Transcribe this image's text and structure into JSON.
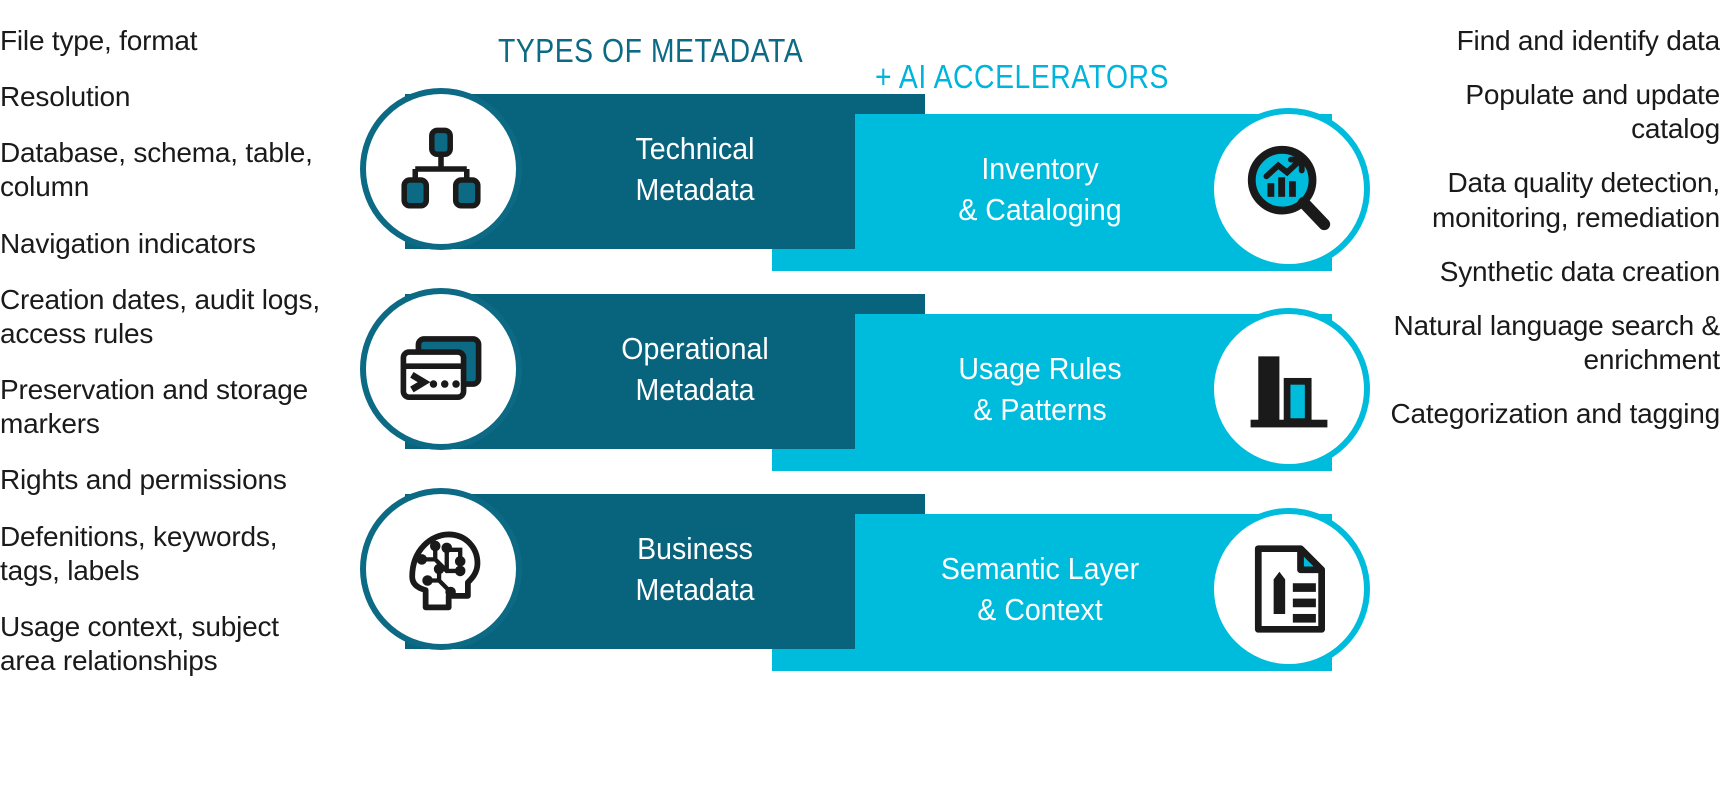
{
  "headings": {
    "left": "TYPES OF METADATA",
    "right": "+ AI ACCELERATORS"
  },
  "colors": {
    "dark_teal": "#08637d",
    "circle_teal": "#0d6a84",
    "cyan": "#00bcdc",
    "heading_cyan": "#00b4dc",
    "text": "#1a1a1a",
    "white": "#ffffff"
  },
  "left_column": [
    {
      "text": "File type, format"
    },
    {
      "text": "Resolution"
    },
    {
      "text": "Database, schema, table, column"
    },
    {
      "text": "Navigation indicators"
    },
    {
      "text": "Creation dates, audit logs, access rules"
    },
    {
      "text": "Preservation and storage markers"
    },
    {
      "text": "Rights and permissions"
    },
    {
      "text": "Defenitions, keywords, tags, labels"
    },
    {
      "text": "Usage context, subject area relationships"
    }
  ],
  "right_column": [
    {
      "text": "Find and identify data"
    },
    {
      "text": "Populate and update catalog"
    },
    {
      "text": "Data quality detection, monitoring, remediation"
    },
    {
      "text": "Synthetic data creation"
    },
    {
      "text": "Natural language search & enrichment"
    },
    {
      "text": "Categorization and tagging"
    }
  ],
  "rows": [
    {
      "metadata_label": "Technical\nMetadata",
      "accelerator_label": "Inventory\n& Cataloging",
      "metadata_icon": "hierarchy-tree-icon",
      "accelerator_icon": "magnifier-bar-chart-icon"
    },
    {
      "metadata_label": "Operational\nMetadata",
      "accelerator_label": "Usage Rules\n& Patterns",
      "metadata_icon": "terminal-console-icon",
      "accelerator_icon": "bar-chart-icon"
    },
    {
      "metadata_label": "Business\nMetadata",
      "accelerator_label": "Semantic Layer\n& Context",
      "metadata_icon": "ai-brain-head-icon",
      "accelerator_icon": "document-edit-icon"
    }
  ]
}
